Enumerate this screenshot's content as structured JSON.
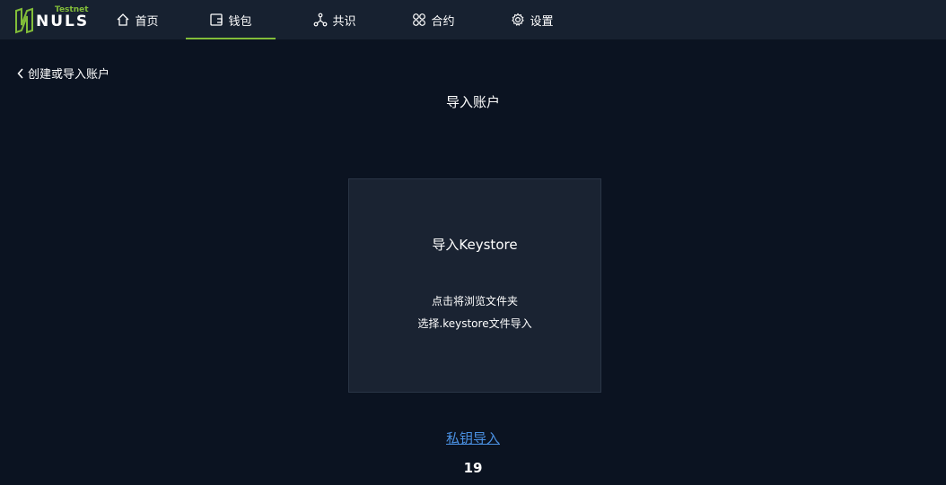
{
  "brand": {
    "name": "NULS",
    "tag": "Testnet",
    "accent": "#82bd39"
  },
  "nav": [
    {
      "label": "首页",
      "icon": "home-icon",
      "active": false
    },
    {
      "label": "钱包",
      "icon": "wallet-icon",
      "active": true
    },
    {
      "label": "共识",
      "icon": "consensus-icon",
      "active": false
    },
    {
      "label": "合约",
      "icon": "contract-icon",
      "active": false
    },
    {
      "label": "设置",
      "icon": "gear-icon",
      "active": false
    }
  ],
  "back_link": {
    "label": "创建或导入账户",
    "icon": "chevron-left-icon"
  },
  "page_title": "导入账户",
  "import_card": {
    "title": "导入Keystore",
    "line1": "点击将浏览文件夹",
    "line2": "选择.keystore文件导入"
  },
  "private_key_link": "私钥导入",
  "page_number": "19",
  "colors": {
    "background": "#0b1321",
    "topbar": "#172130",
    "card": "#1a2332",
    "link": "#4a90e2"
  }
}
